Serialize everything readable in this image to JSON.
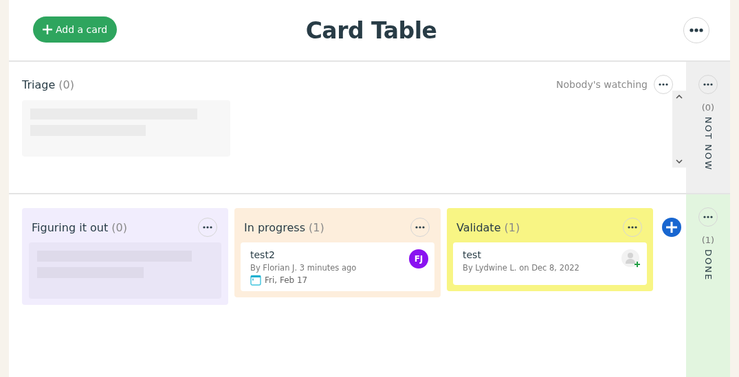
{
  "header": {
    "add_button": "Add a card",
    "title": "Card Table"
  },
  "triage": {
    "title": "Triage",
    "count": "(0)",
    "watching": "Nobody's watching"
  },
  "columns": [
    {
      "title": "Figuring it out",
      "count": "(0)",
      "color": "#f1edfd"
    },
    {
      "title": "In progress",
      "count": "(1)",
      "color": "#fdeedc",
      "cards": [
        {
          "title": "test2",
          "meta": "By Florian J. 3 minutes ago",
          "due": "Fri, Feb 17",
          "assignee": {
            "initials": "FJ",
            "color": "#8a12f0"
          }
        }
      ]
    },
    {
      "title": "Validate",
      "count": "(1)",
      "color": "#f8f584",
      "cards": [
        {
          "title": "test",
          "meta": "By Lydwine L. on Dec 8, 2022"
        }
      ]
    }
  ],
  "side_columns": [
    {
      "label": "NOT NOW",
      "count": "(0)",
      "color": "#efefef"
    },
    {
      "label": "DONE",
      "count": "(1)",
      "color": "#e2f5df"
    }
  ]
}
